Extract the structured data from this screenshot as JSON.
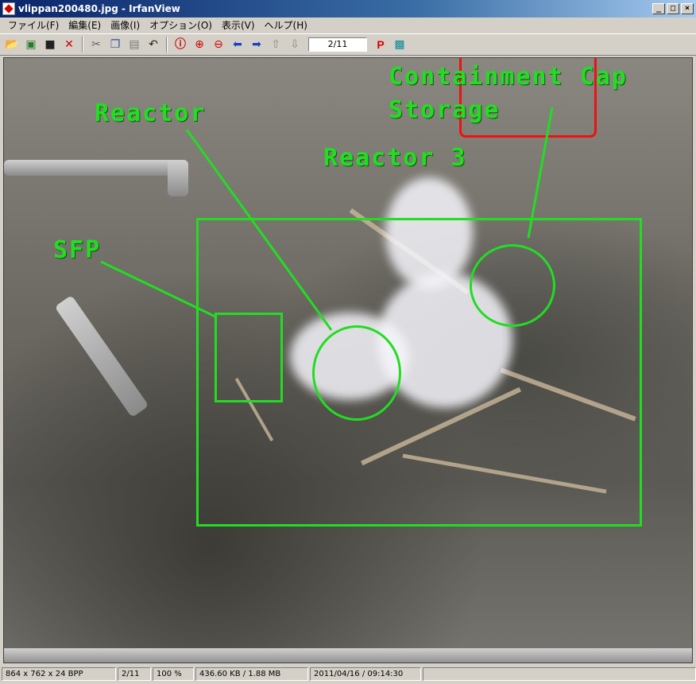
{
  "window": {
    "title": "vlippan200480.jpg - IrfanView"
  },
  "menu": {
    "items": [
      "ファイル(F)",
      "編集(E)",
      "画像(I)",
      "オプション(O)",
      "表示(V)",
      "ヘルプ(H)"
    ]
  },
  "toolbar": {
    "page_indicator": "2/11"
  },
  "annotations": {
    "containment_line1": "Containment Cap",
    "containment_line2": "Storage",
    "reactor": "Reactor",
    "reactor3": "Reactor 3",
    "sfp": "SFP"
  },
  "colors": {
    "annotation": "#22dd22",
    "highlight": "#ee1111"
  },
  "status": {
    "dimensions": "864 x 762 x 24 BPP",
    "page": "2/11",
    "zoom": "100 %",
    "filesize": "436.60 KB / 1.88 MB",
    "datetime": "2011/04/16 / 09:14:30"
  }
}
